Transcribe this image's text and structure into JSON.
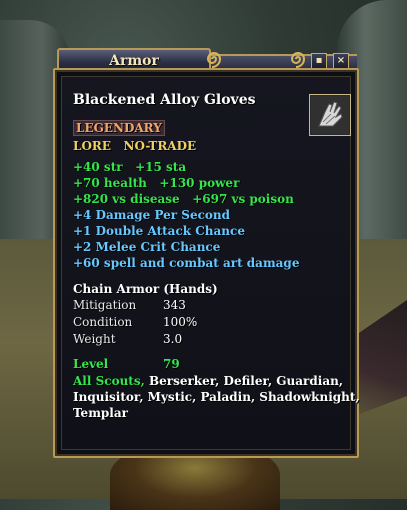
{
  "window": {
    "title": "Armor",
    "minimize_label": "▪",
    "close_label": "×"
  },
  "item": {
    "name": "Blackened Alloy Gloves",
    "rarity": "LEGENDARY",
    "flags": "LORE   NO-TRADE",
    "stats": [
      "+40 str   +15 sta",
      "+70 health   +130 power",
      "+820 vs disease   +697 vs poison"
    ],
    "effects": [
      "+4 Damage Per Second",
      "+1 Double Attack Chance",
      "+2 Melee Crit Chance",
      "+60 spell and combat art damage"
    ],
    "armor_type": "Chain Armor (Hands)",
    "properties": [
      {
        "label": "Mitigation",
        "value": "343"
      },
      {
        "label": "Condition",
        "value": "100%"
      },
      {
        "label": "Weight",
        "value": "3.0"
      }
    ],
    "level_label": "Level",
    "level_value": "79",
    "classes_highlight": "All Scouts,",
    "classes_rest_line1": " Berserker, Defiler, Guardian,",
    "classes_line2": "Inquisitor, Mystic, Paladin, Shadowknight,",
    "classes_line3": "Templar"
  },
  "colors": {
    "stat_green": "#35e64a",
    "effect_blue": "#66c8ff",
    "legendary_orange": "#f2a56a",
    "flag_yellow": "#f0d060",
    "frame_gold": "#b79a57"
  },
  "icons": [
    "gloves-icon",
    "swirl-ornament-icon",
    "minimize-icon",
    "close-icon"
  ]
}
